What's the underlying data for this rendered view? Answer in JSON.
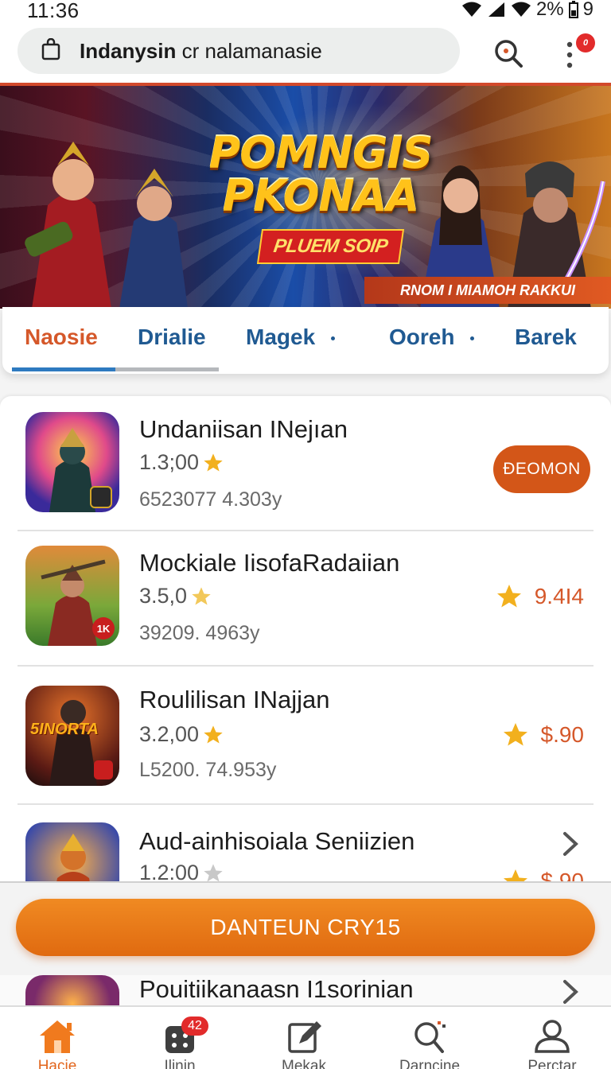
{
  "status_bar": {
    "time": "11:36",
    "battery": "2%",
    "extra": "9"
  },
  "header": {
    "search_text_bold": "Indanysin",
    "search_text_rest": " cr nalamanasie",
    "notification_badge": "0"
  },
  "banner": {
    "title": "POMNGIS PKONAA",
    "subtitle": "PLUEM SOIP",
    "strip_text": "RNOM I MIAMOH RAKKUI"
  },
  "tabs": [
    "Naosie",
    "Drialie",
    "Magek",
    "Ooreh",
    "Barek"
  ],
  "apps": [
    {
      "name": "Undaniisan INejıan",
      "rating": "1.3;00",
      "meta": "6523077 4.303y",
      "action": "ĐEOMON",
      "price": ""
    },
    {
      "name": "Mockiale IisofaRadaiian",
      "rating": "3.5,0",
      "meta": "39209. 4963y",
      "action": "",
      "price": "9.4I4"
    },
    {
      "name": "Roulilisan INajjan",
      "rating": "3.2,00",
      "meta": "L5200. 74.953y",
      "action": "",
      "price": "$.90"
    },
    {
      "name": "Aud-ainhisoiala Seniizien",
      "rating": "1.2:00",
      "meta": "",
      "action": "",
      "price": "$.90"
    },
    {
      "name": "Pouitiikanaasn I1sorinian",
      "rating": "",
      "meta": "",
      "action": "",
      "price": ""
    }
  ],
  "app_icon_labels": [
    "1K",
    "5INORTA"
  ],
  "cta": {
    "label": "DANTEUN CRY15"
  },
  "bottom_nav": [
    {
      "label": "Hacie",
      "icon": "home-icon",
      "badge": ""
    },
    {
      "label": "Ilinin",
      "icon": "games-icon",
      "badge": "42"
    },
    {
      "label": "Mekak",
      "icon": "edit-icon",
      "badge": ""
    },
    {
      "label": "Darncine",
      "icon": "search-icon",
      "badge": ""
    },
    {
      "label": "Perctar",
      "icon": "profile-icon",
      "badge": ""
    }
  ],
  "colors": {
    "accent": "#d5582a",
    "tab_blue": "#205a92",
    "cta_orange": "#e87a18",
    "star": "#f2b01e"
  }
}
